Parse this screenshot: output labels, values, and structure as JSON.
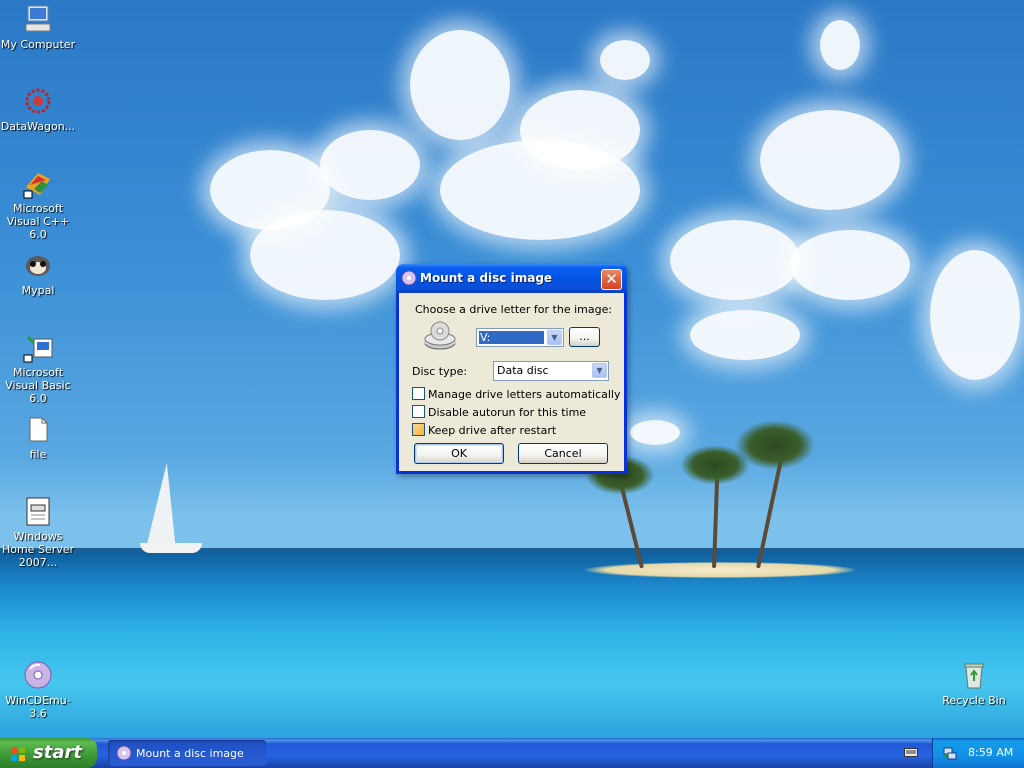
{
  "desktop": {
    "icons": [
      {
        "label": "My Computer",
        "icon": "my-computer-icon"
      },
      {
        "label": "DataWagon...",
        "icon": "datawagon-icon"
      },
      {
        "label": "Microsoft Visual C++ 6.0",
        "icon": "visual-cpp-icon"
      },
      {
        "label": "Mypal",
        "icon": "mypal-browser-icon"
      },
      {
        "label": "Microsoft Visual Basic 6.0",
        "icon": "visual-basic-icon"
      },
      {
        "label": "file",
        "icon": "file-icon"
      },
      {
        "label": "Windows Home Server 2007...",
        "icon": "document-icon"
      },
      {
        "label": "WinCDEmu-3.6",
        "icon": "wincdemu-icon"
      },
      {
        "label": "Recycle Bin",
        "icon": "recycle-bin-icon"
      }
    ]
  },
  "dialog": {
    "title": "Mount a disc image",
    "close_symbol": "✕",
    "drive_prompt": "Choose a drive letter for the image:",
    "drive_letter": "V:",
    "browse_label": "...",
    "disc_type_label": "Disc type:",
    "disc_type_value": "Data disc",
    "options": [
      {
        "label": "Manage drive letters automatically",
        "checked": false
      },
      {
        "label": "Disable autorun for this time",
        "checked": false
      },
      {
        "label": "Keep drive after restart",
        "checked": false
      }
    ],
    "ok_label": "OK",
    "cancel_label": "Cancel"
  },
  "taskbar": {
    "start_label": "start",
    "task_button_label": "Mount a disc image",
    "clock": "8:59 AM"
  },
  "colors": {
    "title_bar": "#0453e2",
    "start_button": "#3f9b3a",
    "dialog_face": "#ece9d8"
  }
}
